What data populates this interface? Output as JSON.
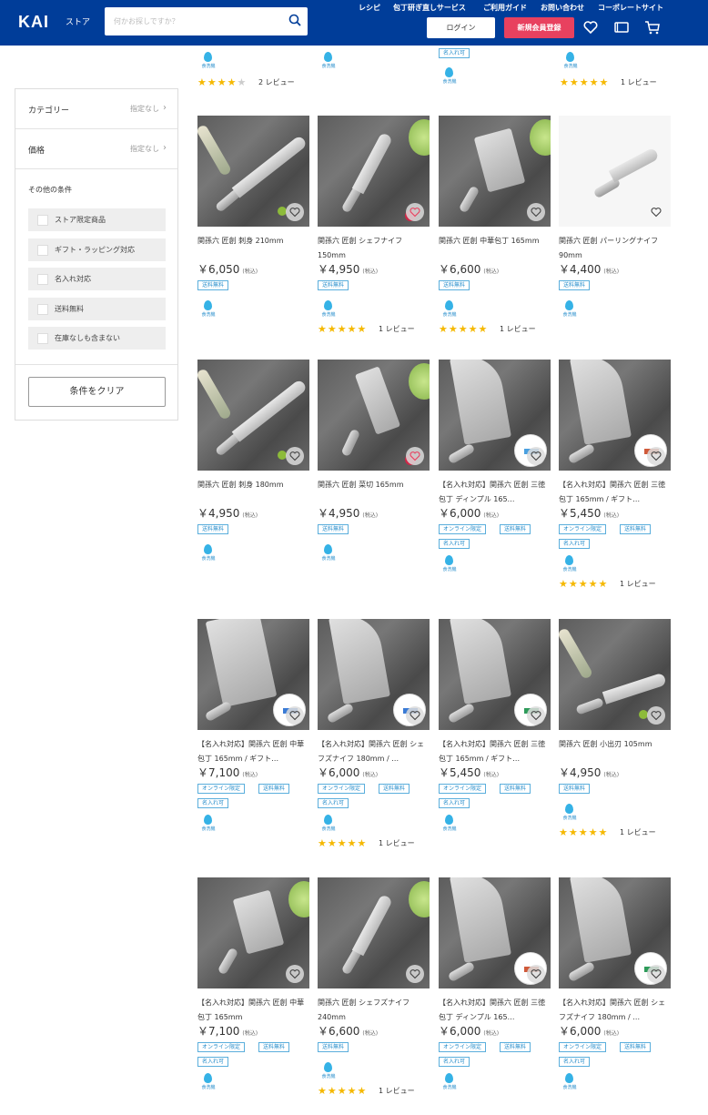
{
  "header": {
    "logo": "KAI",
    "store": "ストア",
    "search_placeholder": "何かお探しですか？",
    "nav": [
      "レシピ",
      "包丁研ぎ直しサービス",
      "ご利用ガイド",
      "お問い合わせ",
      "コーポレートサイト"
    ],
    "login": "ログイン",
    "signup": "新規会員登録",
    "icons": [
      "heart-icon",
      "card-icon",
      "cart-icon"
    ]
  },
  "sidebar": {
    "category_label": "カテゴリー",
    "category_value": "指定なし",
    "price_label": "価格",
    "price_value": "指定なし",
    "other_title": "その他の条件",
    "options": [
      "ストア限定商品",
      "ギフト・ラッピング対応",
      "名入れ対応",
      "送料無料",
      "在庫なしも含まない"
    ],
    "clear": "条件をクリア"
  },
  "common": {
    "tax": "(税込)",
    "free_shipping": "送料無料",
    "online_only": "オンライン限定",
    "engraving": "名入れ可",
    "dishwasher": "食洗機",
    "review_suffix": "レビュー"
  },
  "top_partial": {
    "col1_stars": 4.5,
    "col1_reviews": "2",
    "col4_stars": 5,
    "col4_reviews": "1"
  },
  "products": [
    {
      "name": "関孫六 匠創 刺身 210mm",
      "price": "￥6,050",
      "tags": [
        "送料無料"
      ],
      "rating": null,
      "reviews": null
    },
    {
      "name": "関孫六 匠創 シェフナイフ 150mm",
      "price": "￥4,950",
      "tags": [
        "送料無料"
      ],
      "rating": 5,
      "reviews": "1"
    },
    {
      "name": "関孫六 匠創 中華包丁 165mm",
      "price": "￥6,600",
      "tags": [
        "送料無料"
      ],
      "rating": 5,
      "reviews": "1"
    },
    {
      "name": "関孫六 匠創 パーリングナイフ 90mm",
      "price": "￥4,400",
      "tags": [
        "送料無料"
      ],
      "rating": null,
      "reviews": null
    },
    {
      "name": "関孫六 匠創 刺身 180mm",
      "price": "￥4,950",
      "tags": [
        "送料無料"
      ],
      "rating": null,
      "reviews": null
    },
    {
      "name": "関孫六 匠創 菜切 165mm",
      "price": "￥4,950",
      "tags": [
        "送料無料"
      ],
      "rating": null,
      "reviews": null
    },
    {
      "name": "【名入れ対応】関孫六 匠創 三徳包丁 ディンプル 165…",
      "price": "￥6,000",
      "tags": [
        "オンライン限定",
        "送料無料",
        "名入れ可"
      ],
      "rating": null,
      "reviews": null
    },
    {
      "name": "【名入れ対応】関孫六 匠創 三徳包丁 165mm / ギフト…",
      "price": "￥5,450",
      "tags": [
        "オンライン限定",
        "送料無料",
        "名入れ可"
      ],
      "rating": 5,
      "reviews": "1"
    },
    {
      "name": "【名入れ対応】関孫六 匠創 中華包丁 165mm / ギフト…",
      "price": "￥7,100",
      "tags": [
        "オンライン限定",
        "送料無料",
        "名入れ可"
      ],
      "rating": null,
      "reviews": null
    },
    {
      "name": "【名入れ対応】関孫六 匠創 シェフズナイフ 180mm / …",
      "price": "￥6,000",
      "tags": [
        "オンライン限定",
        "送料無料",
        "名入れ可"
      ],
      "rating": 5,
      "reviews": "1"
    },
    {
      "name": "【名入れ対応】関孫六 匠創 三徳包丁 165mm / ギフト…",
      "price": "￥5,450",
      "tags": [
        "オンライン限定",
        "送料無料",
        "名入れ可"
      ],
      "rating": null,
      "reviews": null
    },
    {
      "name": "関孫六 匠創 小出刃 105mm",
      "price": "￥4,950",
      "tags": [
        "送料無料"
      ],
      "rating": 5,
      "reviews": "1"
    },
    {
      "name": "【名入れ対応】関孫六 匠創 中華包丁 165mm",
      "price": "￥7,100",
      "tags": [
        "オンライン限定",
        "送料無料",
        "名入れ可"
      ],
      "rating": null,
      "reviews": null
    },
    {
      "name": "関孫六 匠創 シェフズナイフ 240mm",
      "price": "￥6,600",
      "tags": [
        "送料無料"
      ],
      "rating": 5,
      "reviews": "1"
    },
    {
      "name": "【名入れ対応】関孫六 匠創 三徳包丁 ディンプル 165…",
      "price": "￥6,000",
      "tags": [
        "オンライン限定",
        "送料無料",
        "名入れ可"
      ],
      "rating": null,
      "reviews": null
    },
    {
      "name": "【名入れ対応】関孫六 匠創 シェフズナイフ 180mm / …",
      "price": "￥6,000",
      "tags": [
        "オンライン限定",
        "送料無料",
        "名入れ可"
      ],
      "rating": null,
      "reviews": null
    }
  ]
}
